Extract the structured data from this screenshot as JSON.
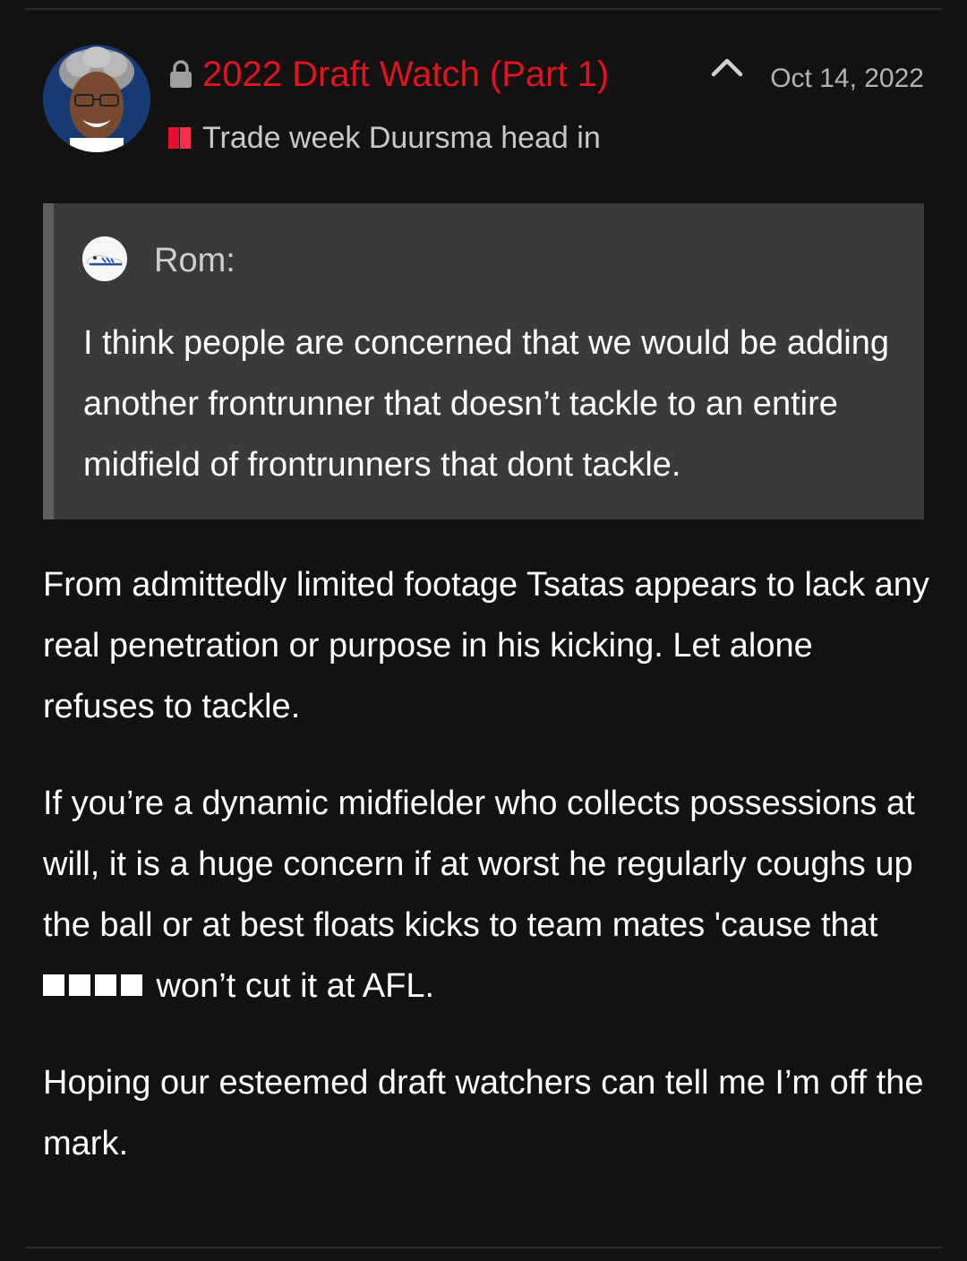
{
  "thread": {
    "title": "2022 Draft Watch (Part 1)",
    "subtitle": "Trade week Duursma head in",
    "date": "Oct 14, 2022",
    "title_color": "#e0141f"
  },
  "icons": {
    "lock": "lock-icon",
    "prefix": "red-prefix-icon",
    "collapse": "chevron-up-icon"
  },
  "quote": {
    "author": "Rom:",
    "text": "I think people are concerned that we would be adding another frontrunner that doesn’t tackle to an entire midfield of frontrunners that dont tackle."
  },
  "post": {
    "paragraphs": [
      {
        "text": "From admittedly limited footage Tsatas appears to lack any real penetration or purpose in his kicking. Let alone refuses to tackle."
      },
      {
        "before": "If you’re a dynamic midfielder who collects possessions at will, it is a huge concern if at worst he regularly coughs up the ball or at best floats kicks to team mates 'cause that ",
        "censored": "■■■■",
        "after": " won’t cut it at AFL."
      },
      {
        "text": "Hoping our esteemed draft watchers can tell me I’m off the mark."
      }
    ]
  }
}
